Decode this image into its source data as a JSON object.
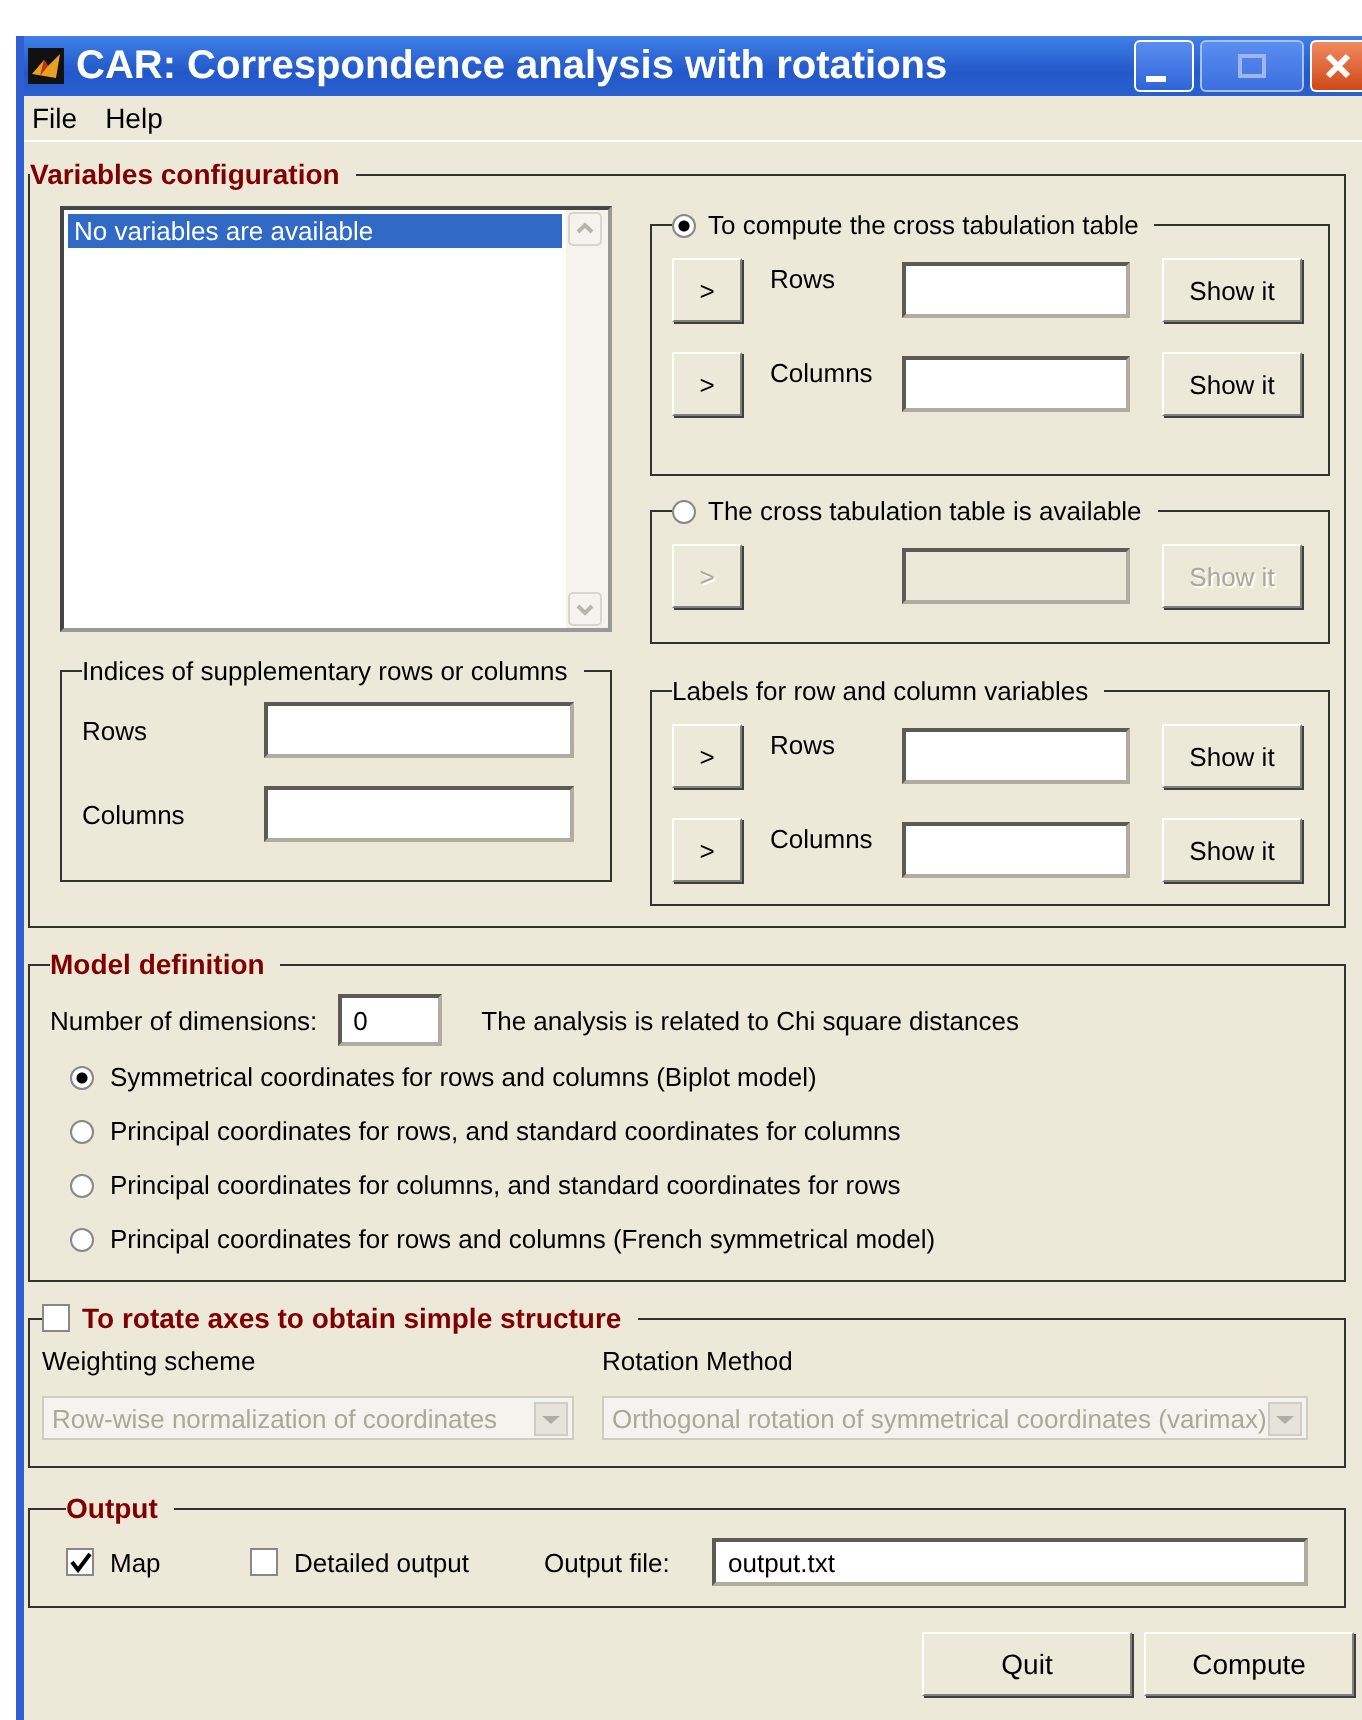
{
  "window": {
    "title": "CAR: Correspondence analysis with rotations"
  },
  "menu": [
    {
      "label": "File"
    },
    {
      "label": "Help"
    }
  ],
  "variables_configuration": {
    "title": "Variables configuration",
    "variable_list": {
      "items": [
        {
          "label": "No variables are available",
          "selected": true
        }
      ]
    },
    "supplementary": {
      "title": "Indices of supplementary rows or columns",
      "fields": [
        {
          "label": "Rows"
        },
        {
          "label": "Columns"
        }
      ]
    },
    "groups": [
      {
        "title": "To compute the cross tabulation table",
        "selected": true,
        "rows": [
          {
            "arrow": ">",
            "label": "Rows",
            "action": "Show it",
            "disabled": false
          },
          {
            "arrow": ">",
            "label": "Columns",
            "action": "Show it",
            "disabled": false
          }
        ]
      },
      {
        "title": "The cross tabulation table is available",
        "selected": false,
        "rows": [
          {
            "arrow": ">",
            "action": "Show it",
            "disabled": true
          }
        ]
      },
      {
        "title": "Labels for row and column variables",
        "rows": [
          {
            "arrow": ">",
            "label": "Rows",
            "action": "Show it",
            "disabled": false
          },
          {
            "arrow": ">",
            "label": "Columns",
            "action": "Show it",
            "disabled": false
          }
        ]
      }
    ]
  },
  "model_definition": {
    "title": "Model definition",
    "dimensions_label": "Number of dimensions:",
    "dimensions_value": "0",
    "note": "The analysis is related to Chi square distances",
    "options": [
      {
        "label": "Symmetrical coordinates for rows and columns (Biplot model)",
        "selected": true
      },
      {
        "label": "Principal coordinates for rows, and standard coordinates for columns",
        "selected": false
      },
      {
        "label": "Principal coordinates for columns, and standard coordinates for rows",
        "selected": false
      },
      {
        "label": "Principal coordinates for rows and columns (French symmetrical model)",
        "selected": false
      }
    ]
  },
  "rotation": {
    "title": "To rotate axes to obtain simple structure",
    "checked": false,
    "selects": [
      {
        "label": "Weighting scheme",
        "value": "Row-wise normalization of coordinates",
        "disabled": true
      },
      {
        "label": "Rotation Method",
        "value": "Orthogonal rotation of symmetrical coordinates (varimax)",
        "disabled": true
      }
    ]
  },
  "output": {
    "title": "Output",
    "options": [
      {
        "label": "Map",
        "checked": true
      },
      {
        "label": "Detailed output",
        "checked": false
      }
    ],
    "file_label": "Output file:",
    "file_value": "output.txt"
  },
  "buttons": [
    {
      "label": "Quit"
    },
    {
      "label": "Compute"
    }
  ]
}
